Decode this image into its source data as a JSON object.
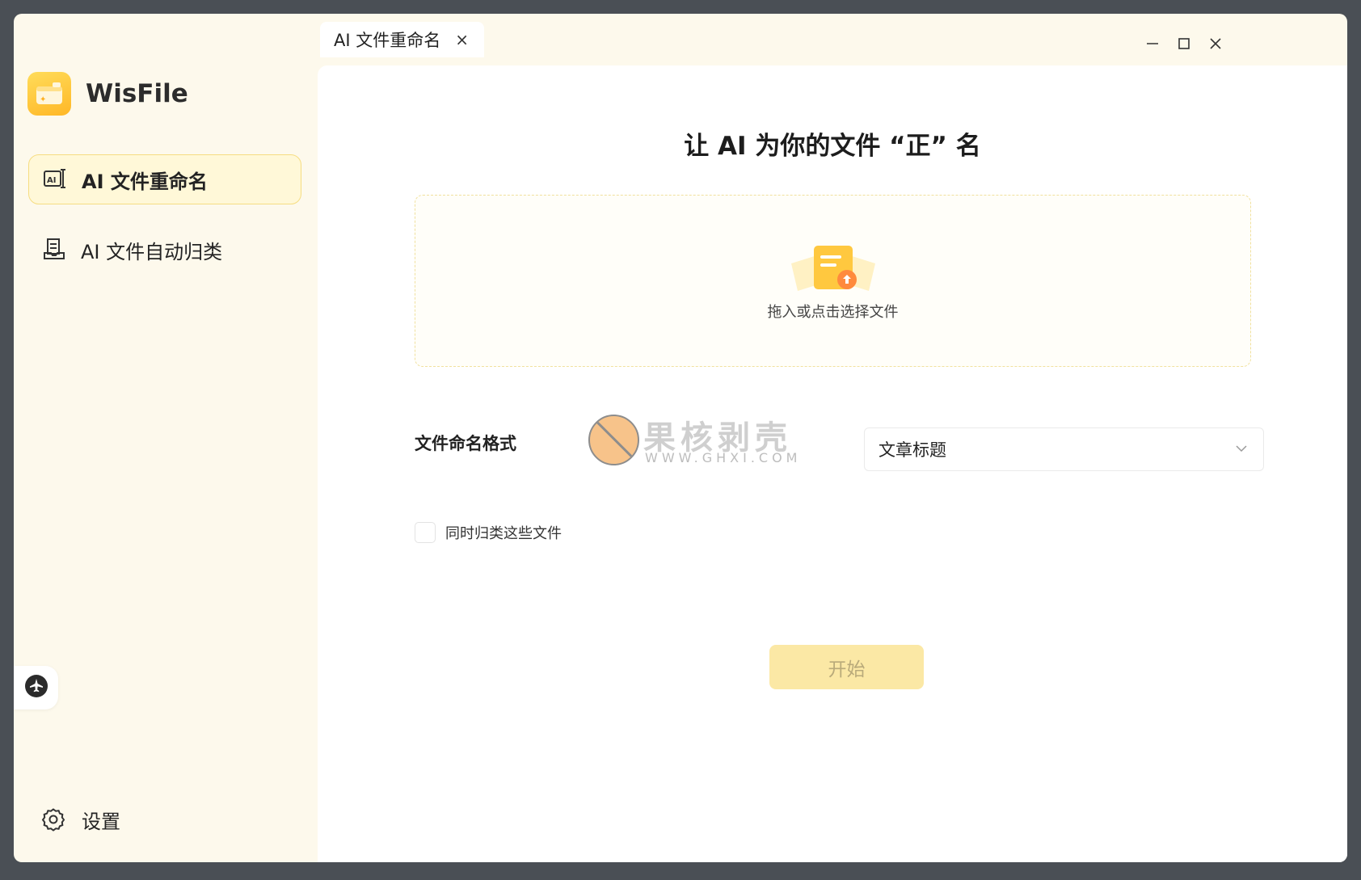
{
  "app": {
    "name": "WisFile",
    "logo_icon": "folder-ai-icon",
    "accent": "#ffc53a"
  },
  "sidebar": {
    "items": [
      {
        "label": "AI 文件重命名",
        "icon": "ai-rename-icon",
        "active": true
      },
      {
        "label": "AI 文件自动归类",
        "icon": "file-classify-icon",
        "active": false
      }
    ],
    "float_icon": "airplane-icon",
    "settings": {
      "label": "设置",
      "icon": "gear-icon"
    }
  },
  "titlebar": {
    "tab": {
      "label": "AI 文件重命名",
      "close": "×"
    },
    "controls": [
      "minimize-icon",
      "maximize-icon",
      "close-icon"
    ]
  },
  "main": {
    "title": "让 AI 为你的文件 “正” 名",
    "dropzone": {
      "text": "拖入或点击选择文件",
      "icon": "file-upload-icon"
    },
    "format": {
      "label": "文件命名格式",
      "selected": "文章标题"
    },
    "classify_checkbox": {
      "label": "同时归类这些文件",
      "checked": false
    },
    "start_button": "开始"
  },
  "watermark": {
    "cn": "果核剥壳",
    "en": "WWW.GHXI.COM"
  }
}
